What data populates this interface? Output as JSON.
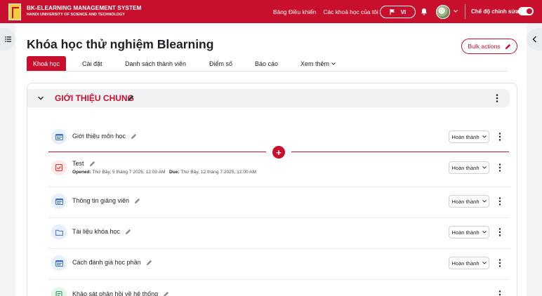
{
  "navbar": {
    "logo_title": "BK-ELEARNING MANAGEMENT SYSTEM",
    "logo_subtitle": "HANOI UNIVERSITY OF SCIENCE AND TECHNOLOGY",
    "links": [
      "Bảng Điều khiển",
      "Các khoá học của tôi"
    ],
    "language": "VI",
    "edit_mode_label": "Chế độ chỉnh sửa",
    "edit_mode_on": true,
    "brand_color": "#c8102e"
  },
  "page": {
    "title": "Khóa học thử nghiệm Blearning",
    "bulk_actions_label": "Bulk actions"
  },
  "tabs": [
    {
      "label": "Khoá học",
      "active": true
    },
    {
      "label": "Cài đặt",
      "active": false
    },
    {
      "label": "Danh sách thành viên",
      "active": false
    },
    {
      "label": "Điểm số",
      "active": false
    },
    {
      "label": "Báo cáo",
      "active": false
    },
    {
      "label": "Xem thêm",
      "active": false,
      "dropdown": true
    }
  ],
  "section": {
    "title": "GIỚI THIỆU CHUNG"
  },
  "activities": [
    {
      "name": "Giới thiệu môn học",
      "icon": "page-icon",
      "completion": "Hoàn thành"
    },
    {
      "name": "Test",
      "icon": "quiz-icon",
      "completion": "Hoàn thành",
      "opened_label": "Opened:",
      "opened_value": "Thứ Bảy, 5 tháng 7 2025, 12:00 AM",
      "due_label": "Due:",
      "due_value": "Thứ Bảy, 12 tháng 7 2025, 12:00 AM"
    },
    {
      "name": "Thông tin giảng viên",
      "icon": "page-icon",
      "completion": "Hoàn thành"
    },
    {
      "name": "Tài liệu khóa học",
      "icon": "folder-icon",
      "completion": "Hoàn thành"
    },
    {
      "name": "Cách đánh giá học phần",
      "icon": "page-icon",
      "completion": "Hoàn thành"
    },
    {
      "name": "Khảo sát phản hồi về hệ thống",
      "icon": "feedback-icon",
      "completion": ""
    }
  ]
}
